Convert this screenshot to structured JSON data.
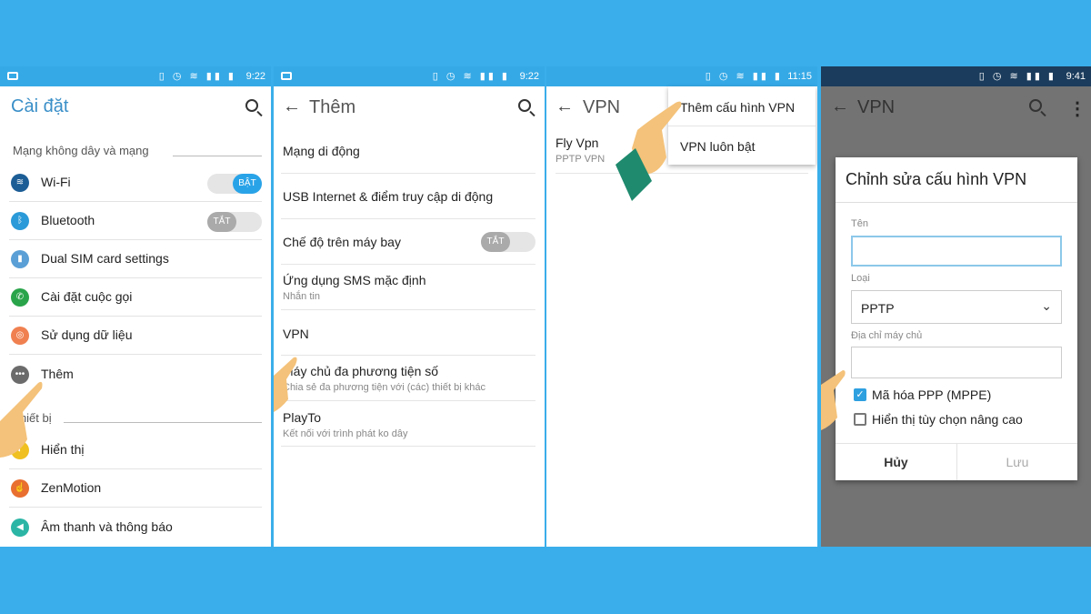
{
  "colors": {
    "background": "#3aaeea",
    "accent": "#35a9e6",
    "toggle_on": "#29a3e8",
    "checkbox": "#2ea0e0"
  },
  "panel1": {
    "time": "9:22",
    "title": "Cài đặt",
    "section1": "Mạng không dây và mạng",
    "section2": "Thiết bị",
    "items": [
      {
        "label": "Wi-Fi",
        "icon": "wifi-icon",
        "toggle": "BẬT",
        "on": true
      },
      {
        "label": "Bluetooth",
        "icon": "bluetooth-icon",
        "toggle": "TẮT",
        "on": false
      },
      {
        "label": "Dual SIM card settings",
        "icon": "sim-icon"
      },
      {
        "label": "Cài đặt cuộc gọi",
        "icon": "phone-icon"
      },
      {
        "label": "Sử dụng dữ liệu",
        "icon": "data-usage-icon"
      },
      {
        "label": "Thêm",
        "icon": "more-icon"
      }
    ],
    "items2": [
      {
        "label": "Hiển thị",
        "icon": "display-icon"
      },
      {
        "label": "ZenMotion",
        "icon": "zenmotion-icon"
      },
      {
        "label": "Âm thanh và thông báo",
        "icon": "sound-icon"
      }
    ]
  },
  "panel2": {
    "time": "9:22",
    "title": "Thêm",
    "items": [
      {
        "title": "Mạng di động"
      },
      {
        "title": "USB Internet & điểm truy cập di động"
      },
      {
        "title": "Chế độ trên máy bay",
        "toggle": "TẮT"
      },
      {
        "title": "Ứng dụng SMS mặc định",
        "subtitle": "Nhắn tin"
      },
      {
        "title": "VPN"
      },
      {
        "title": "Máy chủ đa phương tiện số",
        "subtitle": "Chia sẻ đa phương tiện với (các) thiết bị khác"
      },
      {
        "title": "PlayTo",
        "subtitle": "Kết nối với trình phát ko dây"
      }
    ]
  },
  "panel3": {
    "time": "11:15",
    "title": "VPN",
    "vpn_name": "Fly Vpn",
    "vpn_type": "PPTP VPN",
    "menu": [
      "Thêm cấu hình VPN",
      "VPN luôn bật"
    ]
  },
  "panel4": {
    "time": "9:41",
    "title": "VPN",
    "dialog": {
      "title": "Chỉnh sửa cấu hình VPN",
      "name_label": "Tên",
      "name_value": "",
      "type_label": "Loại",
      "type_value": "PPTP",
      "server_label": "Địa chỉ máy chủ",
      "server_value": "",
      "checkbox1": {
        "label": "Mã hóa PPP (MPPE)",
        "checked": true
      },
      "checkbox2": {
        "label": "Hiển thị tùy chọn nâng cao",
        "checked": false
      },
      "cancel": "Hủy",
      "save": "Lưu"
    }
  }
}
